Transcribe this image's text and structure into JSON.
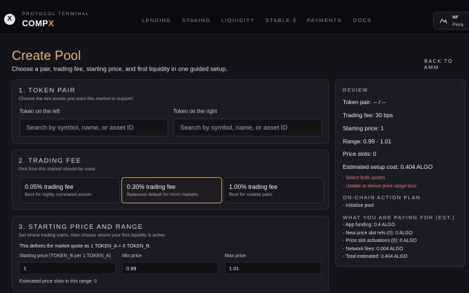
{
  "header": {
    "logo_glyph": "X",
    "brand_sub": "PROTOCOL TERMINAL",
    "brand_main": "COMP",
    "brand_accent": "X",
    "nav": [
      "LENDING",
      "STAKING",
      "LIQUIDITY",
      "STABLE.X",
      "PAYMENTS",
      "DOCS"
    ],
    "wallet": {
      "icon": "wallet-icon",
      "line1": "NF",
      "line2": "Pera"
    }
  },
  "page": {
    "title": "Create Pool",
    "subtitle": "Choose a pair, trading fee, starting price, and first liquidity in one guided setup.",
    "back_link": "BACK TO AMM"
  },
  "token_pair": {
    "title": "1. TOKEN PAIR",
    "desc": "Choose the two assets you want this market to support.",
    "left_label": "Token on the left",
    "right_label": "Token on the right",
    "left_placeholder": "Search by symbol, name, or asset ID",
    "right_placeholder": "Search by symbol, name, or asset ID"
  },
  "trading_fee": {
    "title": "2. TRADING FEE",
    "desc": "Pick how this market should be used.",
    "options": [
      {
        "label": "0.05% trading fee",
        "desc": "Best for highly correlated assets",
        "selected": false
      },
      {
        "label": "0.30% trading fee",
        "desc": "Balanced default for most markets",
        "selected": true
      },
      {
        "label": "1.00% trading fee",
        "desc": "Best for volatile pairs",
        "selected": false
      }
    ]
  },
  "price_range": {
    "title": "3. STARTING PRICE AND RANGE",
    "desc": "Set where trading starts, then choose where your first liquidity is active.",
    "quote_text": "This defines the market quote as 1 TOKEN_A = X TOKEN_B.",
    "start_label": "Starting price (TOKEN_B per 1 TOKEN_A)",
    "start_value": "1",
    "min_label": "Min price",
    "min_value": "0.99",
    "max_label": "Max price",
    "max_value": "1.01",
    "slots_text": "Estimated price slots in this range: 0"
  },
  "review": {
    "heading": "REVIEW",
    "token_pair": "Token pair: -- / --",
    "trading_fee": "Trading fee: 30 bps",
    "starting_price": "Starting price: 1",
    "range": "Range: 0.99 - 1.01",
    "price_slots": "Price slots: 0",
    "setup_cost": "Estimated setup cost: 0.404 ALGO",
    "errors": [
      "- Select both assets",
      "- Unable to derive price range bins"
    ],
    "plan_heading": "ON-CHAIN ACTION PLAN",
    "plan_items": [
      "- Initialize pool"
    ],
    "pay_heading": "WHAT YOU ARE PAYING FOR (EST.)",
    "pay_items": [
      "- App funding: 0.4 ALGO",
      "- New price slot refs (0): 0 ALGO",
      "- Price slot activations (0): 0 ALGO",
      "- Network fees: 0.004 ALGO",
      "- Total estimated: 0.404 ALGO"
    ]
  },
  "colors": {
    "accent_gold": "#e0b070",
    "selected_border": "#c9a35a",
    "error": "#e57b7b",
    "background": "#131419"
  }
}
